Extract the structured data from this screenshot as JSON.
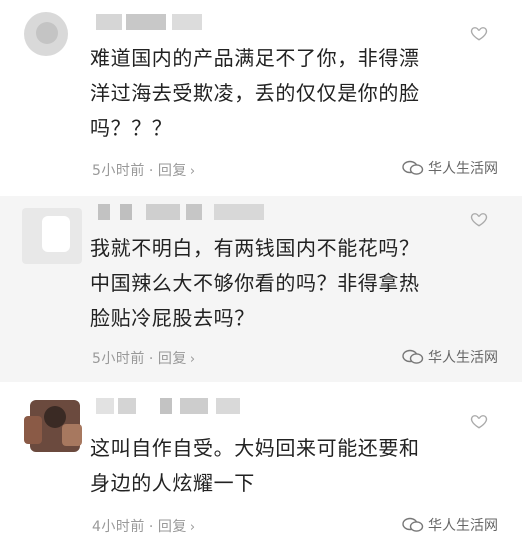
{
  "comments": [
    {
      "text": "难道国内的产品满足不了你，非得漂\n洋过海去受欺凌，丢的仅仅是你的脸\n吗？？？",
      "time": "5小时前",
      "separator": "·",
      "reply": "回复",
      "chevron": "›"
    },
    {
      "text": "我就不明白，有两钱国内不能花吗？\n中国辣么大不够你看的吗？非得拿热\n脸贴冷屁股去吗？",
      "time": "5小时前",
      "separator": "·",
      "reply": "回复",
      "chevron": "›"
    },
    {
      "text": "这叫自作自受。大妈回来可能还要和\n身边的人炫耀一下",
      "time": "4小时前",
      "separator": "·",
      "reply": "回复",
      "chevron": "›"
    }
  ],
  "watermark": "华人生活网",
  "icons": {
    "like": "heart-outline-icon",
    "watermark": "wechat-icon"
  },
  "colors": {
    "text": "#222222",
    "meta": "#999999",
    "heart": "#aaaaaa",
    "alt_bg": "#f5f5f5"
  }
}
